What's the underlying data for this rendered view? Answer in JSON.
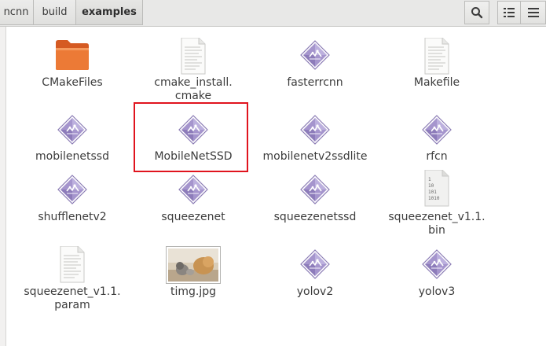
{
  "breadcrumb": {
    "items": [
      {
        "label": "ncnn"
      },
      {
        "label": "build"
      },
      {
        "label": "examples"
      }
    ]
  },
  "toolbar": {
    "search_icon": "search-icon",
    "view_icon": "list-view-icon",
    "menu_icon": "menu-icon"
  },
  "files": [
    {
      "name": "CMakeFiles",
      "type": "folder"
    },
    {
      "name": "cmake_install.\ncmake",
      "type": "text"
    },
    {
      "name": "fasterrcnn",
      "type": "executable"
    },
    {
      "name": "Makefile",
      "type": "text"
    },
    {
      "name": "mobilenetssd",
      "type": "executable"
    },
    {
      "name": "MobileNetSSD",
      "type": "executable",
      "highlighted": true
    },
    {
      "name": "mobilenetv2ssdlite",
      "type": "executable"
    },
    {
      "name": "rfcn",
      "type": "executable"
    },
    {
      "name": "shufflenetv2",
      "type": "executable"
    },
    {
      "name": "squeezenet",
      "type": "executable"
    },
    {
      "name": "squeezenetssd",
      "type": "executable"
    },
    {
      "name": "squeezenet_v1.1.\nbin",
      "type": "binary"
    },
    {
      "name": "squeezenet_v1.1.\nparam",
      "type": "text"
    },
    {
      "name": "timg.jpg",
      "type": "image"
    },
    {
      "name": "yolov2",
      "type": "executable"
    },
    {
      "name": "yolov3",
      "type": "executable"
    }
  ],
  "colors": {
    "highlight_border": "#e0141e",
    "folder": "#e8672c",
    "executable": "#9c8cc4"
  }
}
